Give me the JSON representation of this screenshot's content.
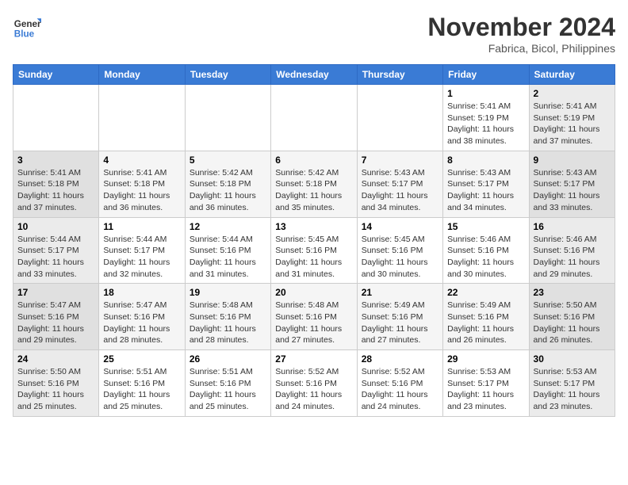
{
  "header": {
    "logo_line1": "General",
    "logo_line2": "Blue",
    "month_title": "November 2024",
    "subtitle": "Fabrica, Bicol, Philippines"
  },
  "weekdays": [
    "Sunday",
    "Monday",
    "Tuesday",
    "Wednesday",
    "Thursday",
    "Friday",
    "Saturday"
  ],
  "weeks": [
    [
      {
        "day": "",
        "info": ""
      },
      {
        "day": "",
        "info": ""
      },
      {
        "day": "",
        "info": ""
      },
      {
        "day": "",
        "info": ""
      },
      {
        "day": "",
        "info": ""
      },
      {
        "day": "1",
        "info": "Sunrise: 5:41 AM\nSunset: 5:19 PM\nDaylight: 11 hours\nand 38 minutes."
      },
      {
        "day": "2",
        "info": "Sunrise: 5:41 AM\nSunset: 5:19 PM\nDaylight: 11 hours\nand 37 minutes."
      }
    ],
    [
      {
        "day": "3",
        "info": "Sunrise: 5:41 AM\nSunset: 5:18 PM\nDaylight: 11 hours\nand 37 minutes."
      },
      {
        "day": "4",
        "info": "Sunrise: 5:41 AM\nSunset: 5:18 PM\nDaylight: 11 hours\nand 36 minutes."
      },
      {
        "day": "5",
        "info": "Sunrise: 5:42 AM\nSunset: 5:18 PM\nDaylight: 11 hours\nand 36 minutes."
      },
      {
        "day": "6",
        "info": "Sunrise: 5:42 AM\nSunset: 5:18 PM\nDaylight: 11 hours\nand 35 minutes."
      },
      {
        "day": "7",
        "info": "Sunrise: 5:43 AM\nSunset: 5:17 PM\nDaylight: 11 hours\nand 34 minutes."
      },
      {
        "day": "8",
        "info": "Sunrise: 5:43 AM\nSunset: 5:17 PM\nDaylight: 11 hours\nand 34 minutes."
      },
      {
        "day": "9",
        "info": "Sunrise: 5:43 AM\nSunset: 5:17 PM\nDaylight: 11 hours\nand 33 minutes."
      }
    ],
    [
      {
        "day": "10",
        "info": "Sunrise: 5:44 AM\nSunset: 5:17 PM\nDaylight: 11 hours\nand 33 minutes."
      },
      {
        "day": "11",
        "info": "Sunrise: 5:44 AM\nSunset: 5:17 PM\nDaylight: 11 hours\nand 32 minutes."
      },
      {
        "day": "12",
        "info": "Sunrise: 5:44 AM\nSunset: 5:16 PM\nDaylight: 11 hours\nand 31 minutes."
      },
      {
        "day": "13",
        "info": "Sunrise: 5:45 AM\nSunset: 5:16 PM\nDaylight: 11 hours\nand 31 minutes."
      },
      {
        "day": "14",
        "info": "Sunrise: 5:45 AM\nSunset: 5:16 PM\nDaylight: 11 hours\nand 30 minutes."
      },
      {
        "day": "15",
        "info": "Sunrise: 5:46 AM\nSunset: 5:16 PM\nDaylight: 11 hours\nand 30 minutes."
      },
      {
        "day": "16",
        "info": "Sunrise: 5:46 AM\nSunset: 5:16 PM\nDaylight: 11 hours\nand 29 minutes."
      }
    ],
    [
      {
        "day": "17",
        "info": "Sunrise: 5:47 AM\nSunset: 5:16 PM\nDaylight: 11 hours\nand 29 minutes."
      },
      {
        "day": "18",
        "info": "Sunrise: 5:47 AM\nSunset: 5:16 PM\nDaylight: 11 hours\nand 28 minutes."
      },
      {
        "day": "19",
        "info": "Sunrise: 5:48 AM\nSunset: 5:16 PM\nDaylight: 11 hours\nand 28 minutes."
      },
      {
        "day": "20",
        "info": "Sunrise: 5:48 AM\nSunset: 5:16 PM\nDaylight: 11 hours\nand 27 minutes."
      },
      {
        "day": "21",
        "info": "Sunrise: 5:49 AM\nSunset: 5:16 PM\nDaylight: 11 hours\nand 27 minutes."
      },
      {
        "day": "22",
        "info": "Sunrise: 5:49 AM\nSunset: 5:16 PM\nDaylight: 11 hours\nand 26 minutes."
      },
      {
        "day": "23",
        "info": "Sunrise: 5:50 AM\nSunset: 5:16 PM\nDaylight: 11 hours\nand 26 minutes."
      }
    ],
    [
      {
        "day": "24",
        "info": "Sunrise: 5:50 AM\nSunset: 5:16 PM\nDaylight: 11 hours\nand 25 minutes."
      },
      {
        "day": "25",
        "info": "Sunrise: 5:51 AM\nSunset: 5:16 PM\nDaylight: 11 hours\nand 25 minutes."
      },
      {
        "day": "26",
        "info": "Sunrise: 5:51 AM\nSunset: 5:16 PM\nDaylight: 11 hours\nand 25 minutes."
      },
      {
        "day": "27",
        "info": "Sunrise: 5:52 AM\nSunset: 5:16 PM\nDaylight: 11 hours\nand 24 minutes."
      },
      {
        "day": "28",
        "info": "Sunrise: 5:52 AM\nSunset: 5:16 PM\nDaylight: 11 hours\nand 24 minutes."
      },
      {
        "day": "29",
        "info": "Sunrise: 5:53 AM\nSunset: 5:17 PM\nDaylight: 11 hours\nand 23 minutes."
      },
      {
        "day": "30",
        "info": "Sunrise: 5:53 AM\nSunset: 5:17 PM\nDaylight: 11 hours\nand 23 minutes."
      }
    ]
  ]
}
